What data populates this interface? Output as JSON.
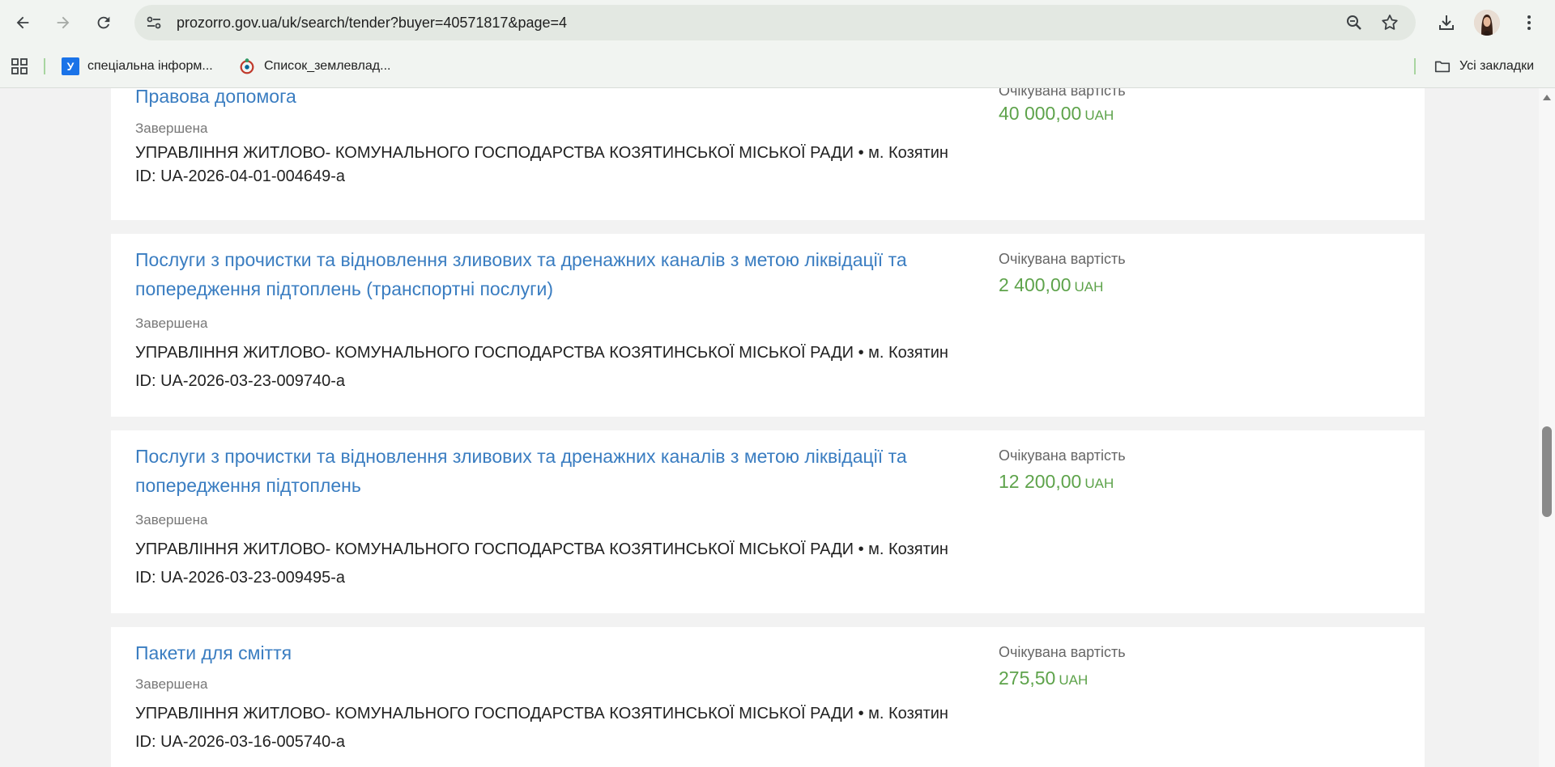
{
  "browser": {
    "url": "prozorro.gov.ua/uk/search/tender?buyer=40571817&page=4",
    "bookmarks": [
      {
        "label": "спеціальна інформ...",
        "icon": "u-favicon"
      },
      {
        "label": "Список_землевлад...",
        "icon": "wikimedia-favicon"
      }
    ],
    "all_bookmarks_label": "Усі закладки"
  },
  "tenders": [
    {
      "title": "Правова допомога",
      "status": "Завершена",
      "buyer": "УПРАВЛІННЯ ЖИТЛОВО- КОМУНАЛЬНОГО ГОСПОДАРСТВА КОЗЯТИНСЬКОЇ МІСЬКОЇ РАДИ • м. Козятин",
      "id": "ID: UA-2026-04-01-004649-a",
      "value_label": "Очікувана вартість",
      "amount": "40 000,00",
      "currency": "UAH"
    },
    {
      "title": "Послуги з прочистки та відновлення зливових та дренажних каналів з метою ліквідації та попередження підтоплень (транспортні послуги)",
      "status": "Завершена",
      "buyer": "УПРАВЛІННЯ ЖИТЛОВО- КОМУНАЛЬНОГО ГОСПОДАРСТВА КОЗЯТИНСЬКОЇ МІСЬКОЇ РАДИ • м. Козятин",
      "id": "ID: UA-2026-03-23-009740-a",
      "value_label": "Очікувана вартість",
      "amount": "2 400,00",
      "currency": "UAH"
    },
    {
      "title": "Послуги з прочистки та відновлення зливових та дренажних каналів з метою ліквідації та попередження підтоплень",
      "status": "Завершена",
      "buyer": "УПРАВЛІННЯ ЖИТЛОВО- КОМУНАЛЬНОГО ГОСПОДАРСТВА КОЗЯТИНСЬКОЇ МІСЬКОЇ РАДИ • м. Козятин",
      "id": "ID: UA-2026-03-23-009495-a",
      "value_label": "Очікувана вартість",
      "amount": "12 200,00",
      "currency": "UAH"
    },
    {
      "title": "Пакети для сміття",
      "status": "Завершена",
      "buyer": "УПРАВЛІННЯ ЖИТЛОВО- КОМУНАЛЬНОГО ГОСПОДАРСТВА КОЗЯТИНСЬКОЇ МІСЬКОЇ РАДИ • м. Козятин",
      "id": "ID: UA-2026-03-16-005740-a",
      "value_label": "Очікувана вартість",
      "amount": "275,50",
      "currency": "UAH"
    }
  ]
}
